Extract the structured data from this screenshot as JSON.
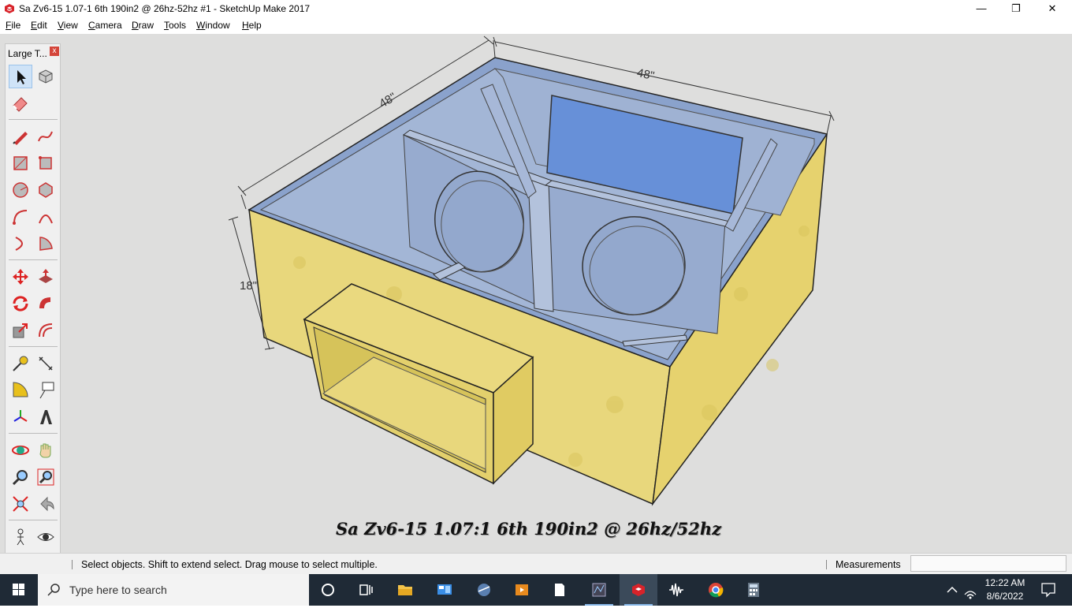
{
  "window": {
    "title": "Sa Zv6-15 1.07-1 6th 190in2 @ 26hz-52hz #1 - SketchUp Make 2017",
    "app_icon": "sketchup-icon",
    "minimize_glyph": "—",
    "maximize_glyph": "❐",
    "close_glyph": "✕"
  },
  "menu": [
    {
      "key": "F",
      "rest": "ile"
    },
    {
      "key": "E",
      "rest": "dit"
    },
    {
      "key": "V",
      "rest": "iew"
    },
    {
      "key": "C",
      "rest": "amera"
    },
    {
      "key": "D",
      "rest": "raw"
    },
    {
      "key": "T",
      "rest": "ools"
    },
    {
      "key": "W",
      "rest": "indow"
    },
    {
      "key": "H",
      "rest": "elp"
    }
  ],
  "toolbar": {
    "title": "Large T...",
    "close_glyph": "x",
    "tools": [
      "select",
      "make-component",
      "eraser",
      "line",
      "freehand",
      "rectangle",
      "rotated-rectangle",
      "circle",
      "polygon",
      "arc",
      "two-point-arc",
      "three-point-arc",
      "pie",
      "move",
      "push-pull",
      "rotate",
      "follow-me",
      "scale",
      "offset",
      "tape-measure",
      "dimensions",
      "protractor",
      "text",
      "axes",
      "3d-text",
      "orbit",
      "pan",
      "zoom",
      "zoom-window",
      "zoom-extents",
      "previous-view",
      "position-camera",
      "look-around",
      "walk",
      "section-plane"
    ]
  },
  "model": {
    "dimension_width": "48\"",
    "dimension_depth": "48\"",
    "dimension_height": "18\"",
    "caption": "Sa Zv6-15 1.07:1 6th 190in2 @ 26hz/52hz",
    "colors": {
      "wood": "#e8d77c",
      "glass": "#8aa2cc",
      "background": "#dededd"
    }
  },
  "status": {
    "hint": "Select objects. Shift to extend select. Drag mouse to select multiple.",
    "measurements_label": "Measurements",
    "measurements_value": ""
  },
  "taskbar": {
    "search_placeholder": "Type here to search",
    "time": "12:22 AM",
    "date": "8/6/2022",
    "apps": [
      "cortana",
      "task-view",
      "file-explorer",
      "control-panel",
      "network-app",
      "media-player",
      "document",
      "audio-tool",
      "sketchup",
      "audio-waveform",
      "chrome",
      "calculator"
    ]
  }
}
